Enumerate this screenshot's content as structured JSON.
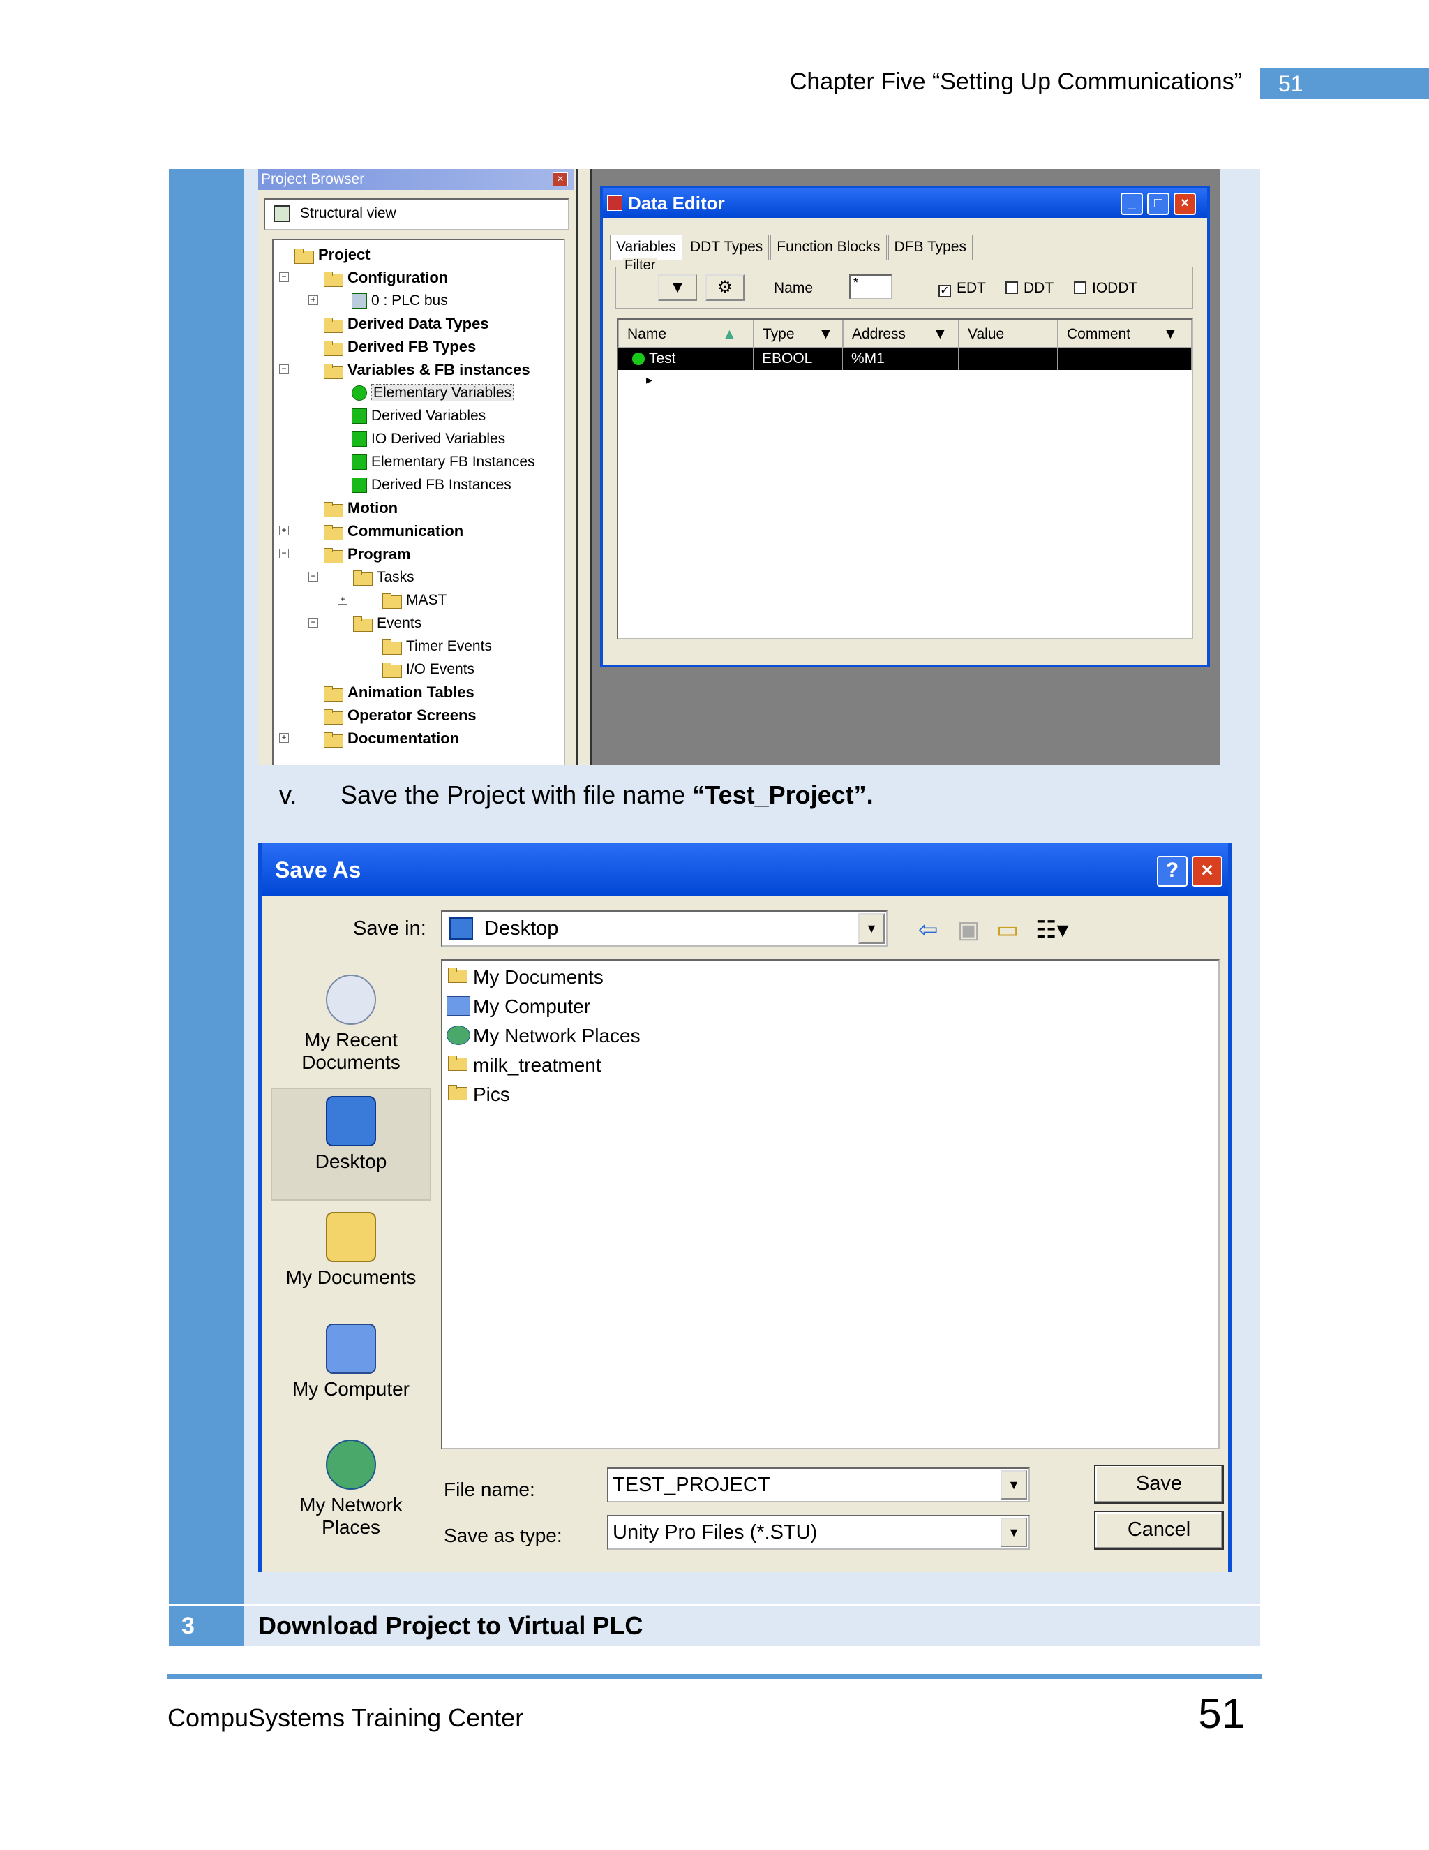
{
  "header": {
    "chapter": "Chapter Five “Setting Up Communications”",
    "page_number": "51"
  },
  "footer": {
    "org": "CompuSystems Training Center",
    "page_number": "51"
  },
  "step": {
    "instruction_number": "v.",
    "instruction_prefix": "Save the Project with file name ",
    "instruction_bold": "“Test_Project”.",
    "next_number": "3",
    "next_title": "Download Project to Virtual PLC"
  },
  "project_browser": {
    "title": "Project Browser",
    "close": "×",
    "view": "Structural view",
    "tree": [
      {
        "label": "Project",
        "bold": true
      },
      {
        "label": "Configuration",
        "bold": true
      },
      {
        "label": "0 : PLC bus",
        "bold": false
      },
      {
        "label": "Derived Data Types",
        "bold": true
      },
      {
        "label": "Derived FB Types",
        "bold": true
      },
      {
        "label": "Variables & FB instances",
        "bold": true
      },
      {
        "label": "Elementary Variables",
        "bold": false
      },
      {
        "label": "Derived Variables",
        "bold": false
      },
      {
        "label": "IO Derived Variables",
        "bold": false
      },
      {
        "label": "Elementary FB Instances",
        "bold": false
      },
      {
        "label": "Derived FB Instances",
        "bold": false
      },
      {
        "label": "Motion",
        "bold": true
      },
      {
        "label": "Communication",
        "bold": true
      },
      {
        "label": "Program",
        "bold": true
      },
      {
        "label": "Tasks",
        "bold": false
      },
      {
        "label": "MAST",
        "bold": false
      },
      {
        "label": "Events",
        "bold": false
      },
      {
        "label": "Timer Events",
        "bold": false
      },
      {
        "label": "I/O Events",
        "bold": false
      },
      {
        "label": "Animation Tables",
        "bold": true
      },
      {
        "label": "Operator Screens",
        "bold": true
      },
      {
        "label": "Documentation",
        "bold": true
      }
    ]
  },
  "data_editor": {
    "title": "Data Editor",
    "tabs": [
      "Variables",
      "DDT Types",
      "Function Blocks",
      "DFB Types"
    ],
    "filter_label": "Filter",
    "filter_name_label": "Name",
    "filter_name_value": "*",
    "checks": [
      {
        "label": "EDT",
        "checked": true
      },
      {
        "label": "DDT",
        "checked": false
      },
      {
        "label": "IODDT",
        "checked": false
      }
    ],
    "columns": [
      "Name",
      "Type",
      "Address",
      "Value",
      "Comment"
    ],
    "row": {
      "name": "Test",
      "type": "EBOOL",
      "address": "%M1",
      "value": "",
      "comment": ""
    },
    "new_row_marker": "▸"
  },
  "save_as": {
    "title": "Save As",
    "help": "?",
    "close": "×",
    "save_in_label": "Save in:",
    "save_in_value": "Desktop",
    "places": [
      {
        "label": "My Recent Documents"
      },
      {
        "label": "Desktop"
      },
      {
        "label": "My Documents"
      },
      {
        "label": "My Computer"
      },
      {
        "label": "My Network Places"
      }
    ],
    "files": [
      "My Documents",
      "My Computer",
      "My Network Places",
      "milk_treatment",
      "Pics"
    ],
    "file_name_label": "File name:",
    "file_name_value": "TEST_PROJECT",
    "save_type_label": "Save as type:",
    "save_type_value": "Unity Pro Files (*.STU)",
    "save_button": "Save",
    "cancel_button": "Cancel"
  }
}
